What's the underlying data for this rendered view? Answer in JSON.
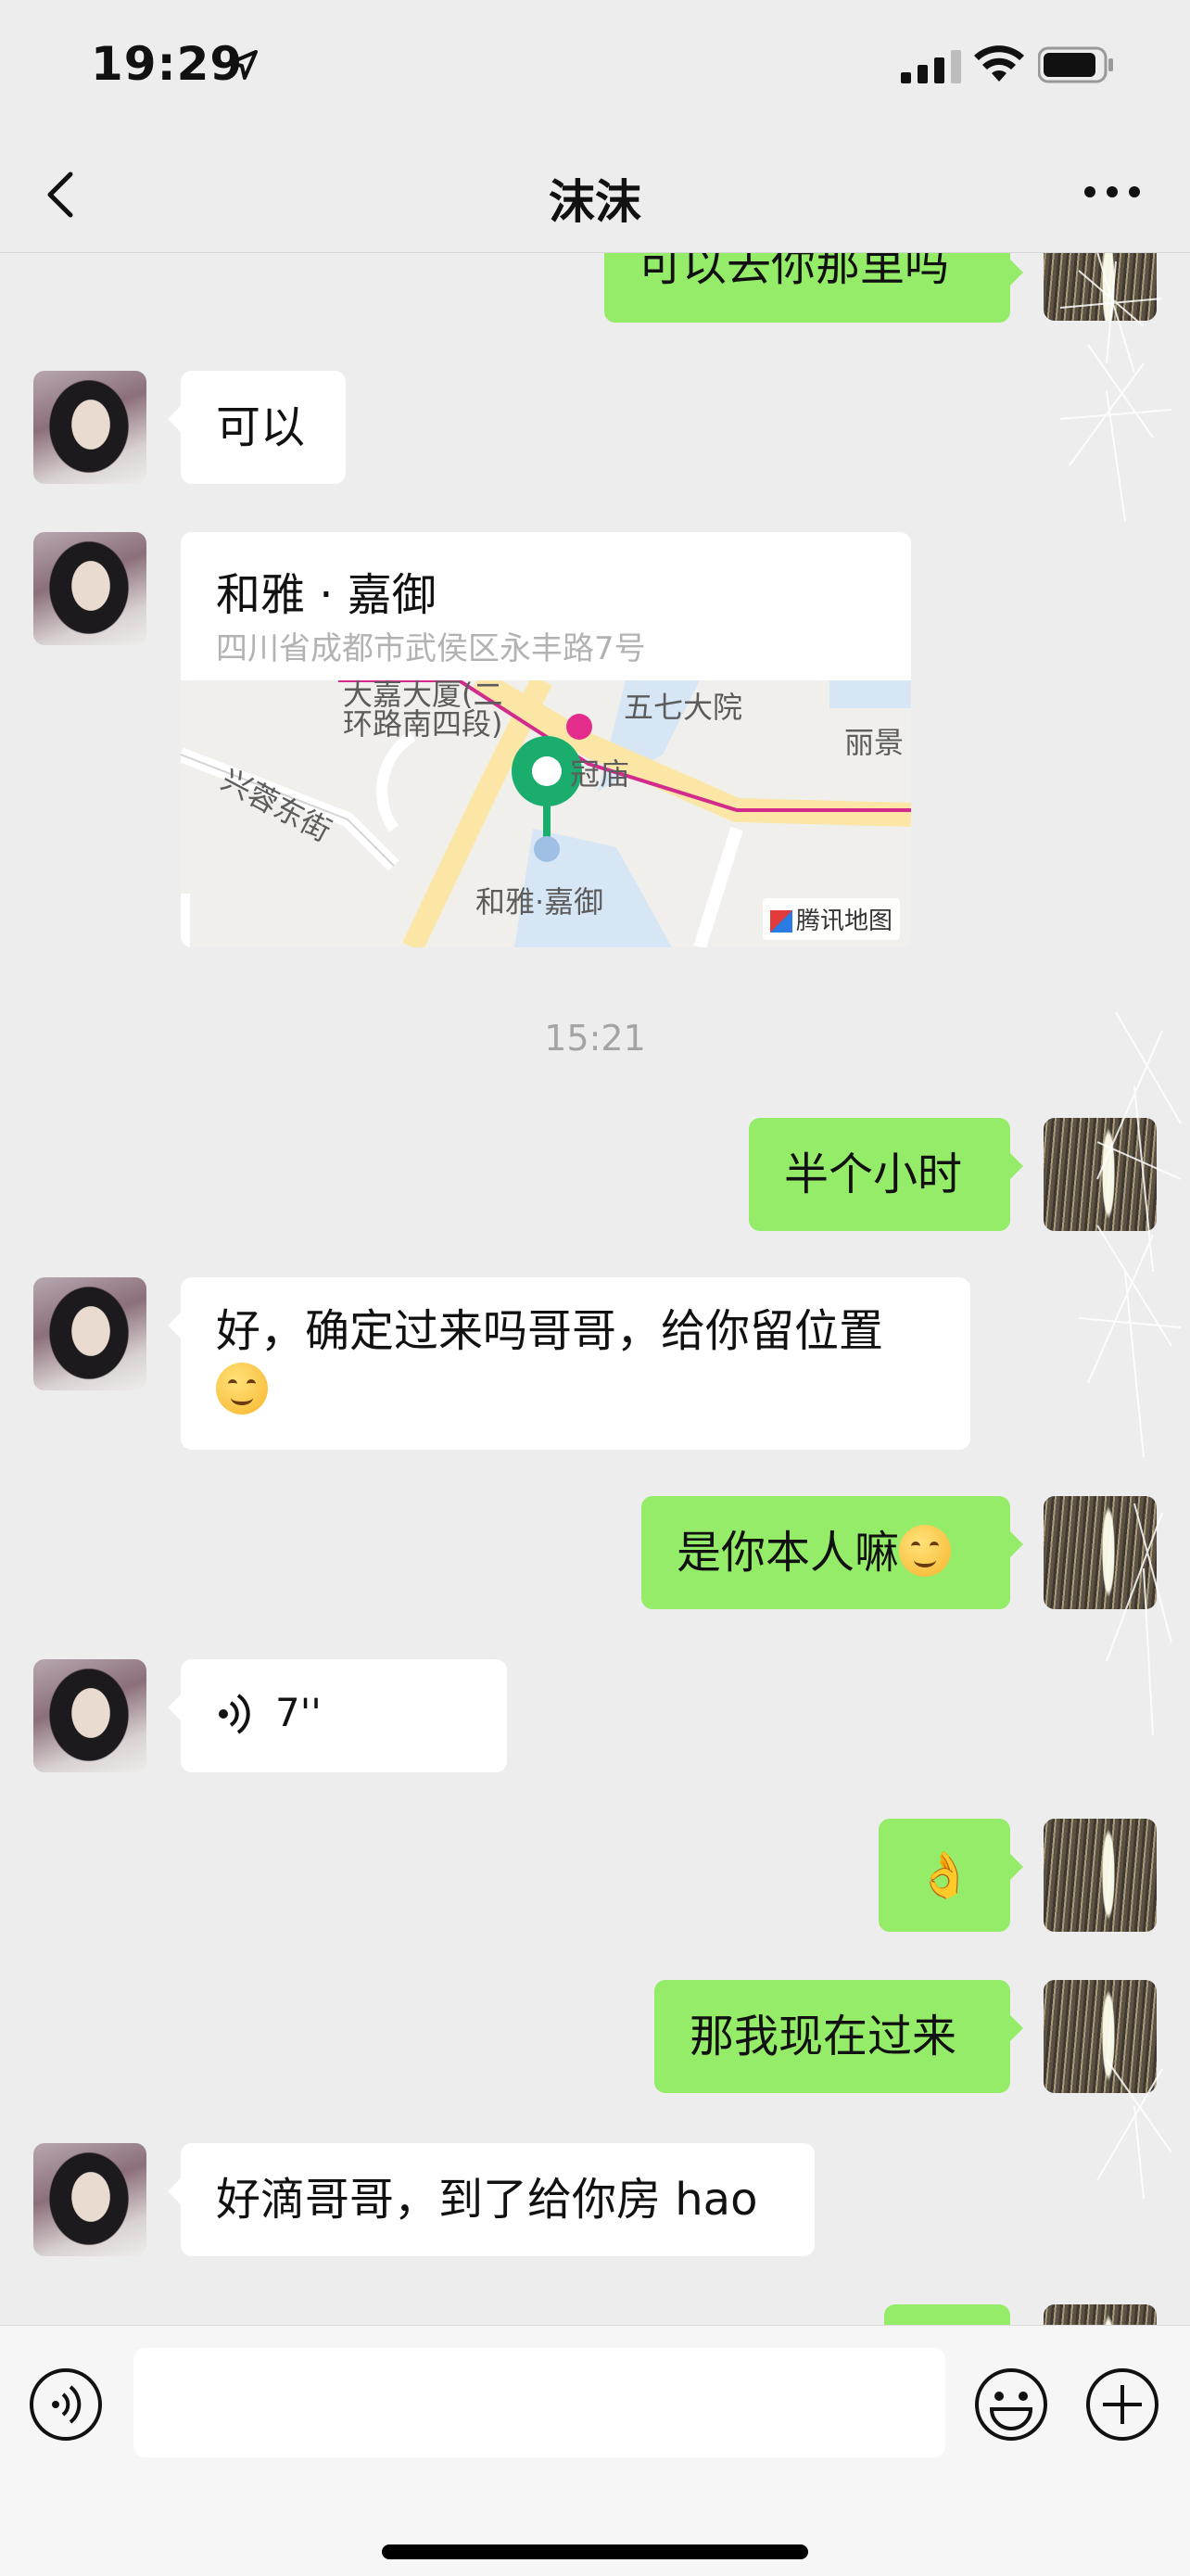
{
  "status_bar": {
    "time": "19:29"
  },
  "nav": {
    "title": "沫沫"
  },
  "messages": {
    "m0": "可以去你那里吗",
    "m1": "可以",
    "location": {
      "name": "和雅 · 嘉御",
      "address": "四川省成都市武侯区永丰路7号",
      "map_labels": {
        "l1": "大嘉大厦(二",
        "l2": "环路南四段)",
        "l3": "五七大院",
        "l4": "丽景",
        "l5": "兴蓉东街",
        "l6": "冠庙",
        "l7": "和雅·嘉御"
      },
      "map_provider": "腾讯地图"
    },
    "time_divider": "15:21",
    "m2": "半个小时",
    "m3": "好，确定过来吗哥哥，给你留位置",
    "m4": "是你本人嘛",
    "voice_duration": "7''",
    "m5_emoji": "👌",
    "m6": "那我现在过来",
    "m7": "好滴哥哥，到了给你房 hao"
  },
  "input": {
    "placeholder": ""
  },
  "icons": {
    "back": "chevron-left-icon",
    "more": "more-dots-icon",
    "voice": "voice-icon",
    "emoji": "emoji-icon",
    "plus": "plus-icon",
    "signal": "signal-icon",
    "wifi": "wifi-icon",
    "battery": "battery-icon"
  },
  "colors": {
    "outgoing_bubble": "#95ec69",
    "incoming_bubble": "#ffffff",
    "background": "#ededed"
  }
}
